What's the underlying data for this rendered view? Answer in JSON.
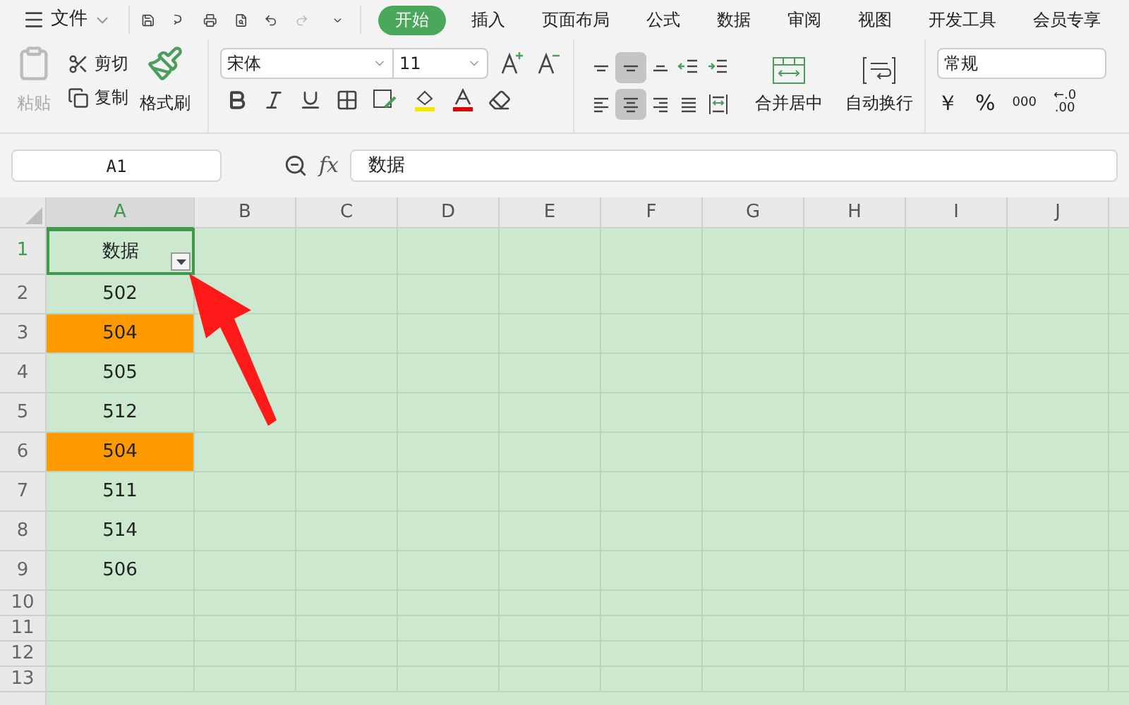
{
  "menu": {
    "file_label": "文件",
    "tabs": [
      {
        "label": "开始",
        "selected": true
      },
      {
        "label": "插入",
        "selected": false
      },
      {
        "label": "页面布局",
        "selected": false
      },
      {
        "label": "公式",
        "selected": false
      },
      {
        "label": "数据",
        "selected": false
      },
      {
        "label": "审阅",
        "selected": false
      },
      {
        "label": "视图",
        "selected": false
      },
      {
        "label": "开发工具",
        "selected": false
      },
      {
        "label": "会员专享",
        "selected": false
      }
    ]
  },
  "ribbon": {
    "paste": {
      "label": "粘贴",
      "disabled": true
    },
    "cut_label": "剪切",
    "copy_label": "复制",
    "format_painter_label": "格式刷",
    "font_name": "宋体",
    "font_size": "11",
    "alignment": [
      {
        "kind": "top",
        "selected": false
      },
      {
        "kind": "middle",
        "selected": true
      },
      {
        "kind": "bottom",
        "selected": false
      },
      {
        "kind": "outdent",
        "selected": false
      },
      {
        "kind": "indent",
        "selected": false
      },
      {
        "kind": "left",
        "selected": false
      },
      {
        "kind": "center",
        "selected": true
      },
      {
        "kind": "right",
        "selected": false
      },
      {
        "kind": "justify",
        "selected": false
      },
      {
        "kind": "distributed",
        "selected": false
      }
    ],
    "merge_label": "合并居中",
    "wrap_label": "自动换行",
    "number_format": "常规",
    "currency": "￥",
    "percent": "%",
    "thousands": "000",
    "decimal_increase": [
      "←.0",
      ".00"
    ]
  },
  "name_box": "A1",
  "function_label": "fx",
  "formula": "数据",
  "sheet": {
    "columns": [
      {
        "label": "A",
        "selected": true
      },
      {
        "label": "B",
        "selected": false
      },
      {
        "label": "C",
        "selected": false
      },
      {
        "label": "D",
        "selected": false
      },
      {
        "label": "E",
        "selected": false
      },
      {
        "label": "F",
        "selected": false
      },
      {
        "label": "G",
        "selected": false
      },
      {
        "label": "H",
        "selected": false
      },
      {
        "label": "I",
        "selected": false
      },
      {
        "label": "J",
        "selected": false
      }
    ],
    "rows": [
      {
        "label": "1",
        "selected": true,
        "cell": {
          "text": "数据",
          "selected": true,
          "filter": true
        }
      },
      {
        "label": "2",
        "selected": false,
        "cell": {
          "text": "502",
          "selected": false
        }
      },
      {
        "label": "3",
        "selected": false,
        "cell": {
          "text": "504",
          "selected": false,
          "color": "#ff9900"
        }
      },
      {
        "label": "4",
        "selected": false,
        "cell": {
          "text": "505",
          "selected": false
        }
      },
      {
        "label": "5",
        "selected": false,
        "cell": {
          "text": "512",
          "selected": false
        }
      },
      {
        "label": "6",
        "selected": false,
        "cell": {
          "text": "504",
          "selected": false,
          "color": "#ff9900"
        }
      },
      {
        "label": "7",
        "selected": false,
        "cell": {
          "text": "511",
          "selected": false
        }
      },
      {
        "label": "8",
        "selected": false,
        "cell": {
          "text": "514",
          "selected": false
        }
      },
      {
        "label": "9",
        "selected": false,
        "cell": {
          "text": "506",
          "selected": false
        }
      },
      {
        "label": "10",
        "selected": false
      },
      {
        "label": "11",
        "selected": false
      },
      {
        "label": "12",
        "selected": false
      },
      {
        "label": "13",
        "selected": false
      }
    ]
  }
}
